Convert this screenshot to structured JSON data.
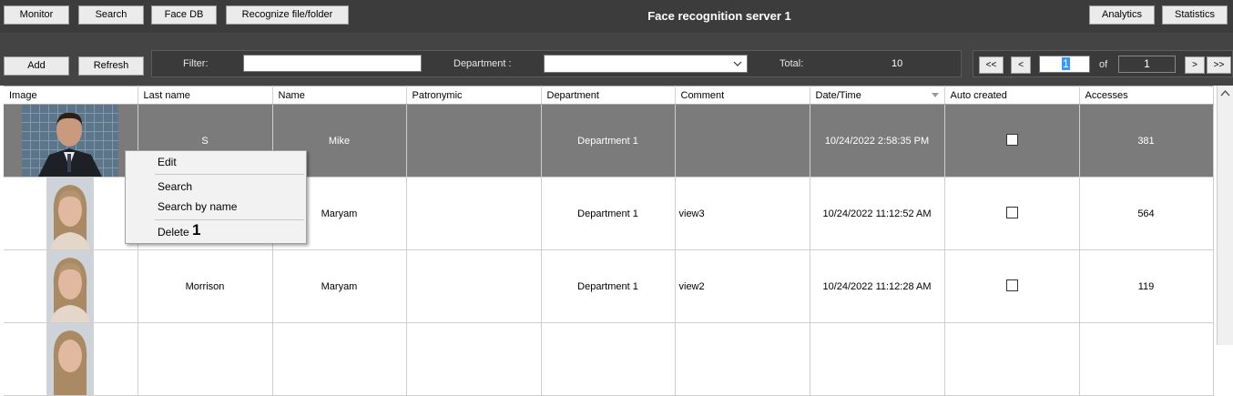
{
  "toolbar": {
    "monitor": "Monitor",
    "search": "Search",
    "face_db": "Face DB",
    "recognize": "Recognize file/folder",
    "analytics": "Analytics",
    "statistics": "Statistics"
  },
  "title": "Face recognition server 1",
  "actions": {
    "add": "Add",
    "refresh": "Refresh"
  },
  "filter": {
    "filter_label": "Filter:",
    "filter_value": "",
    "department_label": "Department :",
    "department_value": "",
    "total_label": "Total:",
    "total_value": "10"
  },
  "pager": {
    "first": "<<",
    "prev": "<",
    "page": "1",
    "of_label": "of",
    "pages": "1",
    "next": ">",
    "last": ">>"
  },
  "columns": [
    "Image",
    "Last name",
    "Name",
    "Patronymic",
    "Department",
    "Comment",
    "Date/Time",
    "Auto created",
    "Accesses"
  ],
  "rows": [
    {
      "last_name": "S",
      "name": "Mike",
      "patronymic": "",
      "department": "Department 1",
      "comment": "",
      "datetime": "10/24/2022 2:58:35 PM",
      "auto_created": false,
      "accesses": "381"
    },
    {
      "last_name": "",
      "name": "Maryam",
      "patronymic": "",
      "department": "Department 1",
      "comment": "view3",
      "datetime": "10/24/2022 11:12:52 AM",
      "auto_created": false,
      "accesses": "564"
    },
    {
      "last_name": "Morrison",
      "name": "Maryam",
      "patronymic": "",
      "department": "Department 1",
      "comment": "view2",
      "datetime": "10/24/2022 11:12:28 AM",
      "auto_created": false,
      "accesses": "119"
    }
  ],
  "context_menu": {
    "edit": "Edit",
    "search": "Search",
    "search_by_name": "Search by name",
    "delete": "Delete",
    "callout": "1"
  }
}
